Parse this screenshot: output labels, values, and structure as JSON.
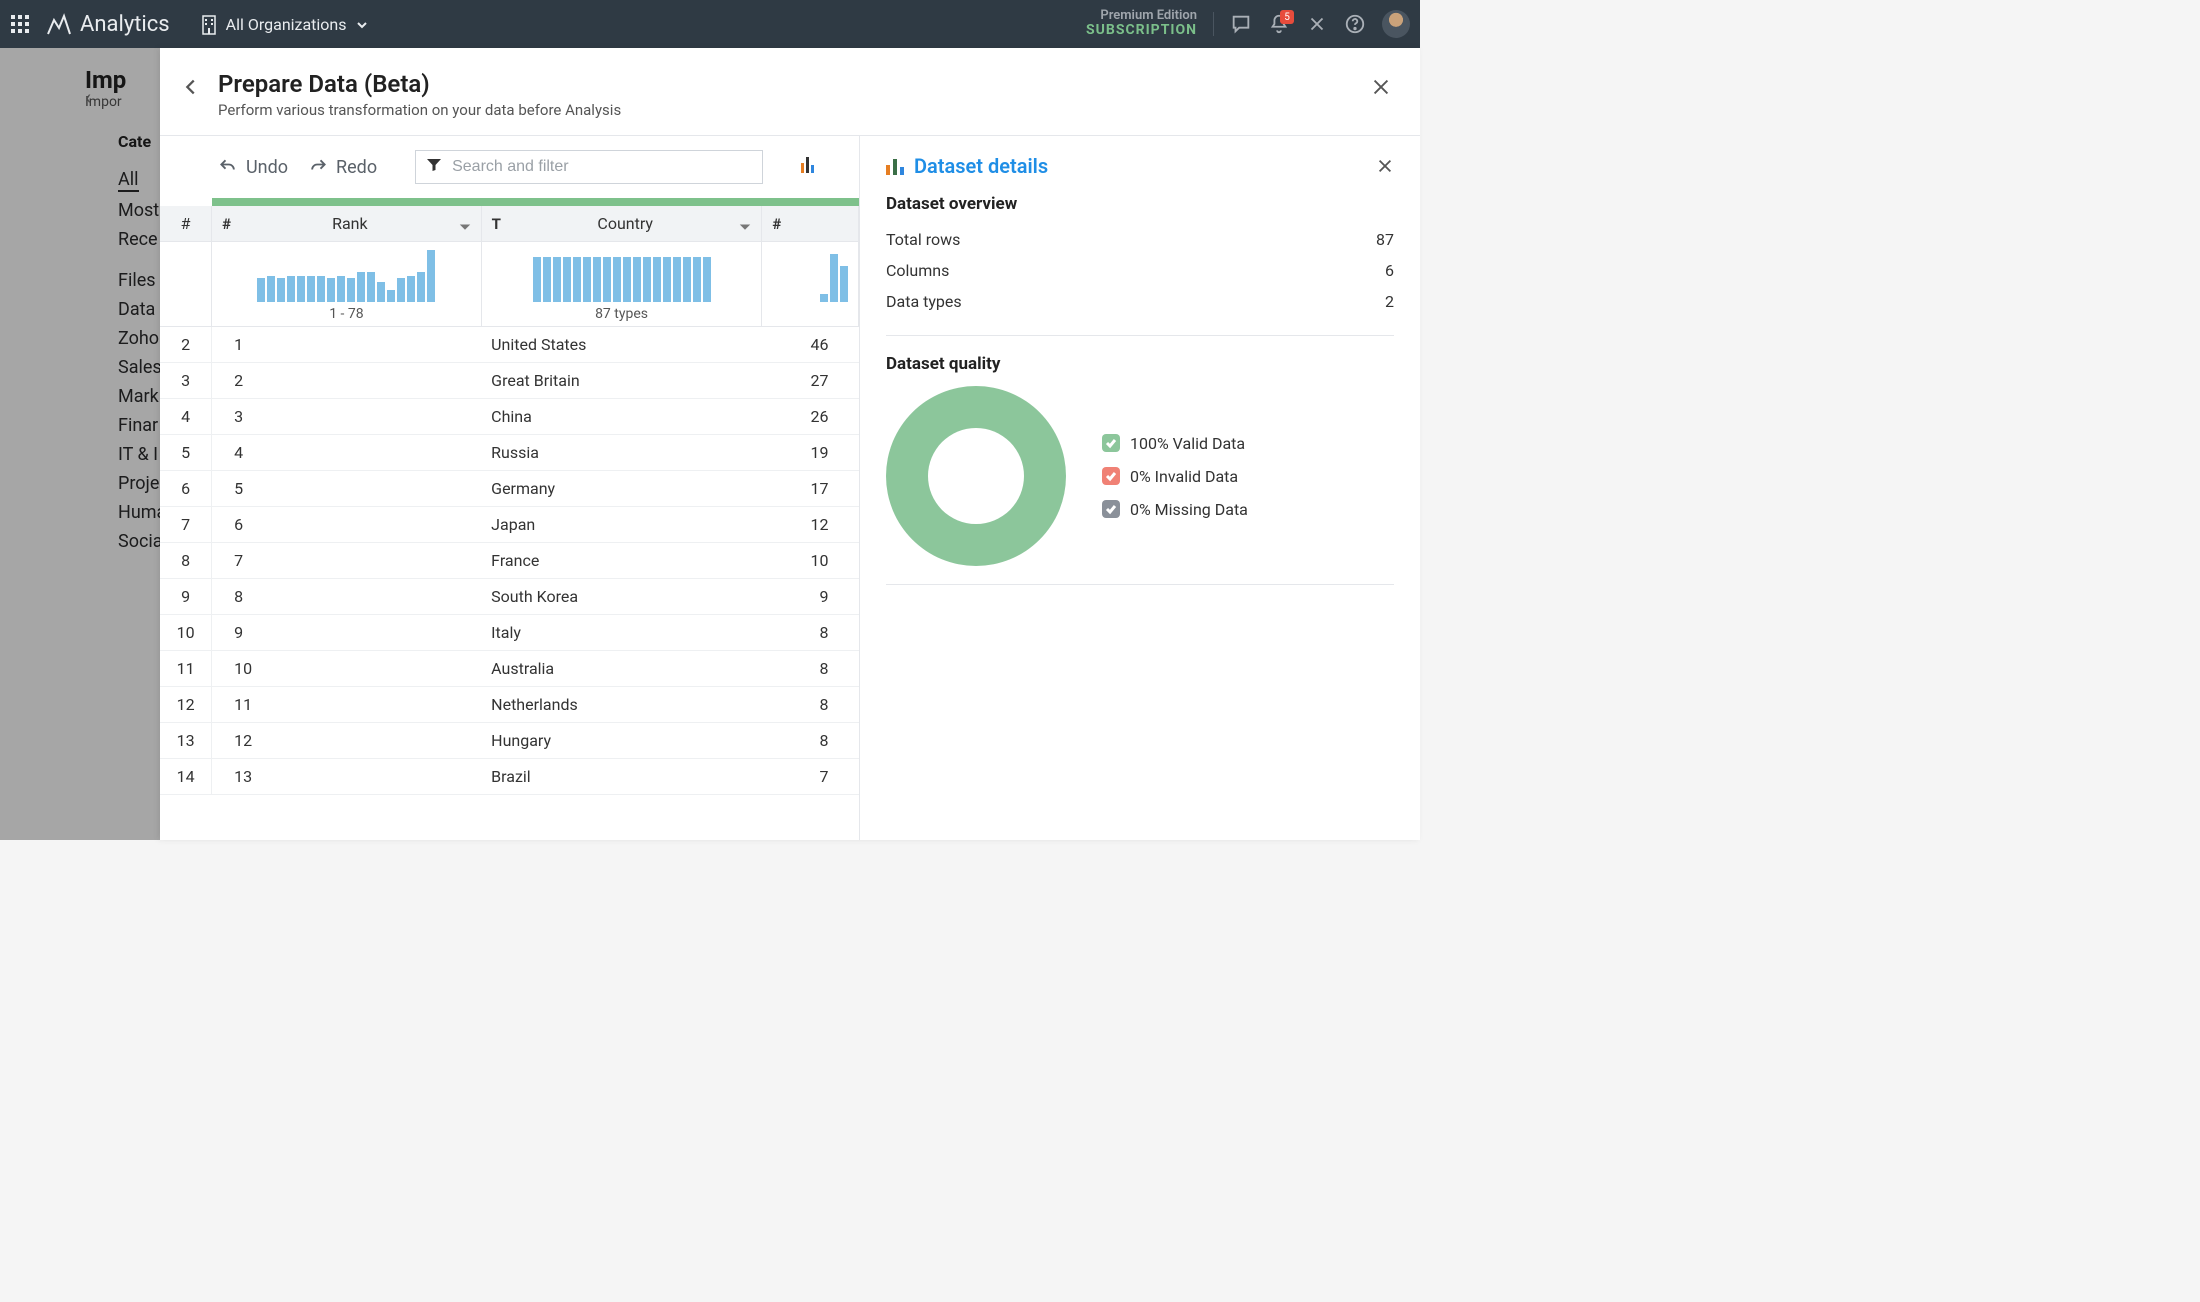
{
  "navbar": {
    "brand": "Analytics",
    "org": "All Organizations",
    "edition_line1": "Premium Edition",
    "edition_line2": "SUBSCRIPTION",
    "notif_count": "5"
  },
  "under": {
    "title": "Imp",
    "subtitle": "Impor",
    "categories_label": "Cate",
    "items": [
      "All",
      "Most",
      "Rece",
      "Files",
      "Data",
      "Zoho",
      "Sales",
      "Mark",
      "Finar",
      "IT & I",
      "Proje",
      "Huma",
      "Socia"
    ]
  },
  "panel": {
    "title": "Prepare Data (Beta)",
    "subtitle": "Perform various transformation on your data before Analysis",
    "undo": "Undo",
    "redo": "Redo",
    "search_placeholder": "Search and filter"
  },
  "columns": {
    "idx_symbol": "#",
    "rank_label": "Rank",
    "rank_type": "#",
    "country_label": "Country",
    "country_type": "T",
    "val_type": "#",
    "rank_dist_label": "1 - 78",
    "country_dist_label": "87 types"
  },
  "rank_dist_heights": [
    24,
    26,
    24,
    26,
    26,
    26,
    26,
    24,
    26,
    24,
    30,
    30,
    20,
    12,
    24,
    26,
    30,
    52
  ],
  "country_dist_heights": [
    45,
    45,
    45,
    45,
    45,
    45,
    45,
    45,
    45,
    45,
    45,
    45,
    45,
    45,
    45,
    45,
    45,
    45
  ],
  "val_dist_heights": [
    8,
    48,
    36
  ],
  "rows": [
    {
      "idx": "2",
      "rank": "1",
      "country": "United States",
      "val": "46"
    },
    {
      "idx": "3",
      "rank": "2",
      "country": "Great Britain",
      "val": "27"
    },
    {
      "idx": "4",
      "rank": "3",
      "country": "China",
      "val": "26"
    },
    {
      "idx": "5",
      "rank": "4",
      "country": "Russia",
      "val": "19"
    },
    {
      "idx": "6",
      "rank": "5",
      "country": "Germany",
      "val": "17"
    },
    {
      "idx": "7",
      "rank": "6",
      "country": "Japan",
      "val": "12"
    },
    {
      "idx": "8",
      "rank": "7",
      "country": "France",
      "val": "10"
    },
    {
      "idx": "9",
      "rank": "8",
      "country": "South Korea",
      "val": "9"
    },
    {
      "idx": "10",
      "rank": "9",
      "country": "Italy",
      "val": "8"
    },
    {
      "idx": "11",
      "rank": "10",
      "country": "Australia",
      "val": "8"
    },
    {
      "idx": "12",
      "rank": "11",
      "country": "Netherlands",
      "val": "8"
    },
    {
      "idx": "13",
      "rank": "12",
      "country": "Hungary",
      "val": "8"
    },
    {
      "idx": "14",
      "rank": "13",
      "country": "Brazil",
      "val": "7"
    }
  ],
  "details": {
    "title": "Dataset details",
    "overview_title": "Dataset overview",
    "overview": [
      {
        "label": "Total rows",
        "value": "87"
      },
      {
        "label": "Columns",
        "value": "6"
      },
      {
        "label": "Data types",
        "value": "2"
      }
    ],
    "quality_title": "Dataset quality",
    "legend": [
      {
        "label": "100% Valid Data",
        "color": "green"
      },
      {
        "label": "0% Invalid Data",
        "color": "red"
      },
      {
        "label": "0% Missing Data",
        "color": "grey"
      }
    ]
  },
  "chart_data": {
    "type": "pie",
    "title": "Dataset quality",
    "series": [
      {
        "name": "Valid Data",
        "value": 100
      },
      {
        "name": "Invalid Data",
        "value": 0
      },
      {
        "name": "Missing Data",
        "value": 0
      }
    ]
  }
}
